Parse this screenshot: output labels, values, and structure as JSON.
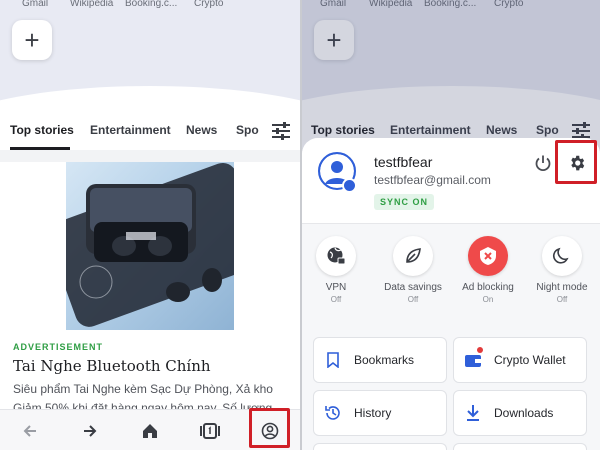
{
  "left_screen": {
    "speed_dial": [
      "Gmail",
      "Wikipedia",
      "Booking.c...",
      "Crypto"
    ],
    "add_button": "+",
    "tabs": [
      "Top stories",
      "Entertainment",
      "News",
      "Spo"
    ],
    "feed": {
      "ad_label": "ADVERTISEMENT",
      "title": "Tai Nghe Bluetooth Chính",
      "text_line1": "Siêu phẩm Tai Nghe kèm Sạc Dự Phòng, Xả kho",
      "text_line2": "Giảm 50% khi đặt hàng ngay hôm nay. Số lượng"
    }
  },
  "right_screen": {
    "speed_dial": [
      "Gmail",
      "Wikipedia",
      "Booking.c...",
      "Crypto"
    ],
    "add_button": "+",
    "tabs": [
      "Top stories",
      "Entertainment",
      "News",
      "Spo"
    ],
    "profile": {
      "username": "testfbfear",
      "email": "testfbfear@gmail.com",
      "sync_status": "SYNC ON"
    },
    "toggles": [
      {
        "label": "VPN",
        "state": "Off",
        "icon": "globe-lock-icon"
      },
      {
        "label": "Data savings",
        "state": "Off",
        "icon": "leaf-icon"
      },
      {
        "label": "Ad blocking",
        "state": "On",
        "icon": "shield-x-icon"
      },
      {
        "label": "Night mode",
        "state": "Off",
        "icon": "moon-icon"
      }
    ],
    "menu": [
      {
        "label": "Bookmarks",
        "icon": "bookmark-icon"
      },
      {
        "label": "Crypto Wallet",
        "icon": "wallet-icon"
      },
      {
        "label": "History",
        "icon": "history-icon"
      },
      {
        "label": "Downloads",
        "icon": "download-icon"
      }
    ]
  },
  "colors": {
    "highlight": "#d01f27",
    "accent_blue": "#2f5fd9",
    "sync_green": "#2f9e44",
    "ad_block_red": "#ef4a4a"
  }
}
